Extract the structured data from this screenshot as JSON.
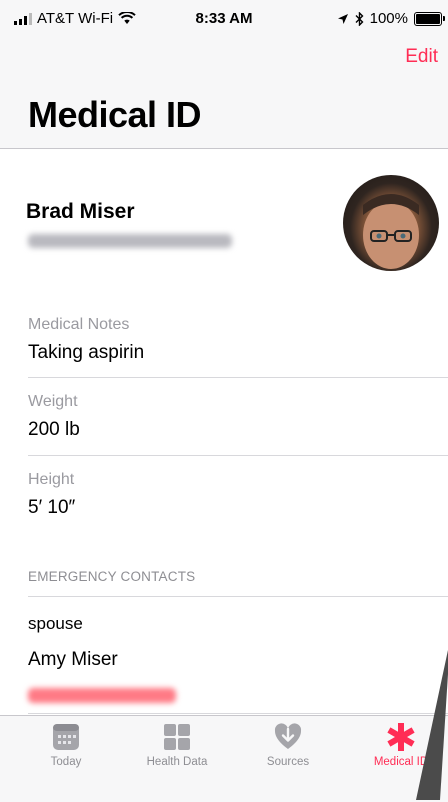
{
  "status_bar": {
    "carrier": "AT&T Wi-Fi",
    "time": "8:33 AM",
    "battery": "100%",
    "icons": [
      "signal-bars-icon",
      "wifi-icon",
      "location-arrow-icon",
      "bluetooth-icon",
      "battery-icon"
    ]
  },
  "nav": {
    "edit_label": "Edit",
    "title": "Medical ID"
  },
  "profile": {
    "name": "Brad Miser"
  },
  "fields": [
    {
      "label": "Medical Notes",
      "value": "Taking aspirin"
    },
    {
      "label": "Weight",
      "value": "200 lb"
    },
    {
      "label": "Height",
      "value": "5′ 10″"
    }
  ],
  "emergency": {
    "header": "EMERGENCY CONTACTS",
    "relation": "spouse",
    "name": "Amy Miser"
  },
  "tabs": [
    {
      "label": "Today",
      "icon": "calendar-icon"
    },
    {
      "label": "Health Data",
      "icon": "grid-icon"
    },
    {
      "label": "Sources",
      "icon": "heart-arrow-icon"
    },
    {
      "label": "Medical ID",
      "icon": "asterisk-icon",
      "active": true
    }
  ],
  "colors": {
    "accent": "#ff2d55",
    "secondary_text": "#8e8e93",
    "bar_background": "#f7f7f8"
  }
}
